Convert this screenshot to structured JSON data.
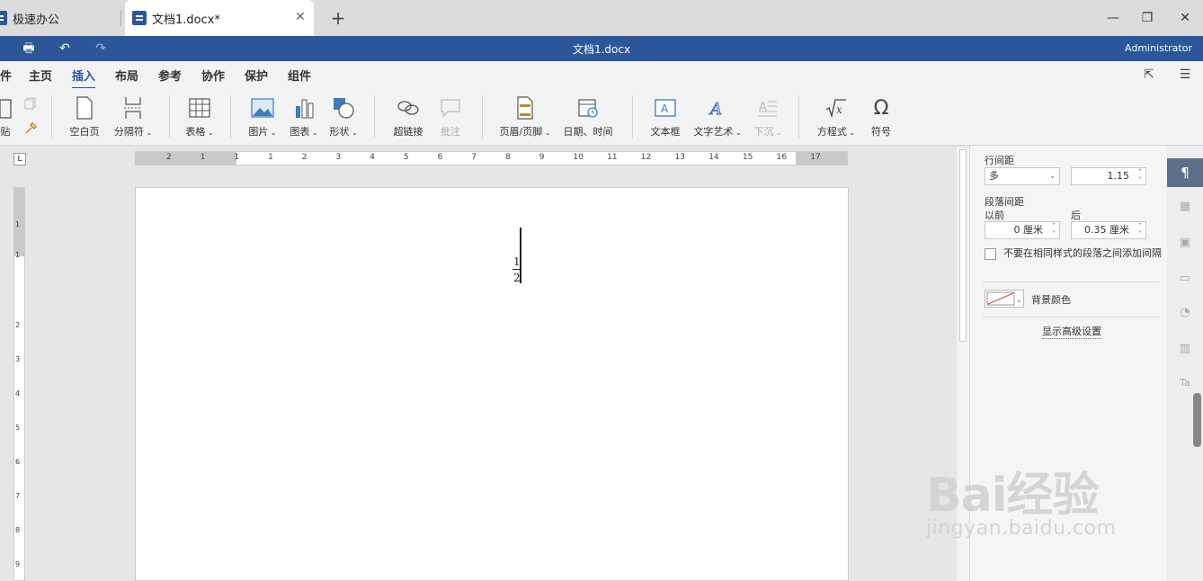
{
  "tabs": [
    {
      "label": "极速办公"
    },
    {
      "label": "文档1.docx*"
    }
  ],
  "titlebar": {
    "title": "文档1.docx",
    "user": "Administrator"
  },
  "menu": {
    "items": [
      "件",
      "主页",
      "插入",
      "布局",
      "参考",
      "协作",
      "保护",
      "组件"
    ],
    "active": "插入"
  },
  "ribbon": {
    "paste": "贴",
    "blank_page": "空白页",
    "page_break": "分隔符",
    "table": "表格",
    "picture": "图片",
    "chart": "图表",
    "shape": "形状",
    "hyperlink": "超链接",
    "comment": "批注",
    "header_footer": "页眉/页脚",
    "datetime": "日期、时间",
    "textbox": "文本框",
    "wordart": "文字艺术",
    "dropcap": "下沉",
    "equation": "方程式",
    "symbol": "符号"
  },
  "ruler": {
    "h_numbers": [
      "2",
      "1",
      "1",
      "1",
      "2",
      "3",
      "4",
      "5",
      "6",
      "7",
      "8",
      "9",
      "10",
      "11",
      "12",
      "13",
      "14",
      "15",
      "16",
      "17"
    ],
    "v_numbers": [
      "1",
      "1",
      "2",
      "3",
      "4",
      "5",
      "6",
      "7",
      "8",
      "9"
    ],
    "tabstop": "L"
  },
  "document": {
    "numerator": "1",
    "denominator": "2"
  },
  "panel": {
    "line_spacing_label": "行间距",
    "line_spacing_mode": "多",
    "line_spacing_value": "1.15",
    "para_spacing_label": "段落间距",
    "before_label": "以前",
    "after_label": "后",
    "before_value": "0 厘米",
    "after_value": "0.35 厘米",
    "no_space_checkbox": "不要在相同样式的段落之间添加间隔",
    "no_space_checked": false,
    "bg_color_label": "背景颜色",
    "advanced_link": "显示高级设置"
  },
  "watermark": {
    "brand": "Bai经验",
    "url": "jingyan.baidu.com"
  },
  "colors": {
    "brand": "#2b579a",
    "sidebar_active": "#5c6f8a"
  }
}
